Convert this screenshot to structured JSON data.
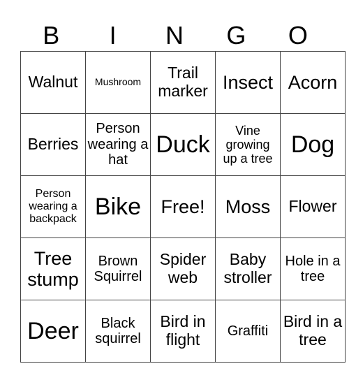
{
  "header": [
    "B",
    "I",
    "N",
    "G",
    "O"
  ],
  "rows": [
    [
      "Walnut",
      "Mushroom",
      "Trail marker",
      "Insect",
      "Acorn"
    ],
    [
      "Berries",
      "Person wearing a hat",
      "Duck",
      "Vine growing up a tree",
      "Dog"
    ],
    [
      "Person wearing a backpack",
      "Bike",
      "Free!",
      "Moss",
      "Flower"
    ],
    [
      "Tree stump",
      "Brown Squirrel",
      "Spider web",
      "Baby stroller",
      "Hole in a tree"
    ],
    [
      "Deer",
      "Black squirrel",
      "Bird in flight",
      "Graffiti",
      "Bird in a tree"
    ]
  ]
}
